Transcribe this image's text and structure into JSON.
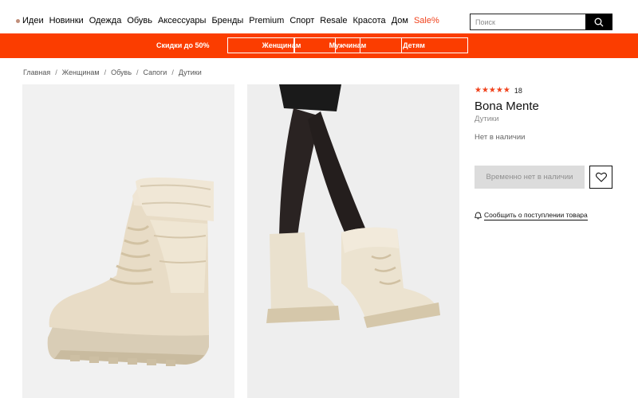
{
  "nav": {
    "items": [
      "Идеи",
      "Новинки",
      "Одежда",
      "Обувь",
      "Аксессуары",
      "Бренды",
      "Premium",
      "Спорт",
      "Resale",
      "Красота",
      "Дом"
    ],
    "sale": "Sale%",
    "search_placeholder": "Поиск"
  },
  "band": {
    "promo": "Скидки до 50%",
    "buttons": [
      "Женщинам",
      "Мужчинам",
      "Детям"
    ]
  },
  "breadcrumb": [
    "Главная",
    "Женщинам",
    "Обувь",
    "Сапоги",
    "Дутики"
  ],
  "product": {
    "stars": "★★★★★",
    "rating_count": "18",
    "brand": "Bona Mente",
    "category": "Дутики",
    "stock_status": "Нет в наличии",
    "unavailable_label": "Временно нет в наличии",
    "notify_label": "Сообщить о поступлении товара"
  },
  "colors": {
    "accent": "#fb3d00",
    "sale": "#f0421c",
    "boot": "#e9dfcc"
  },
  "icons": {
    "search": "search-icon",
    "favorite": "heart-icon",
    "notify": "bell-icon"
  }
}
